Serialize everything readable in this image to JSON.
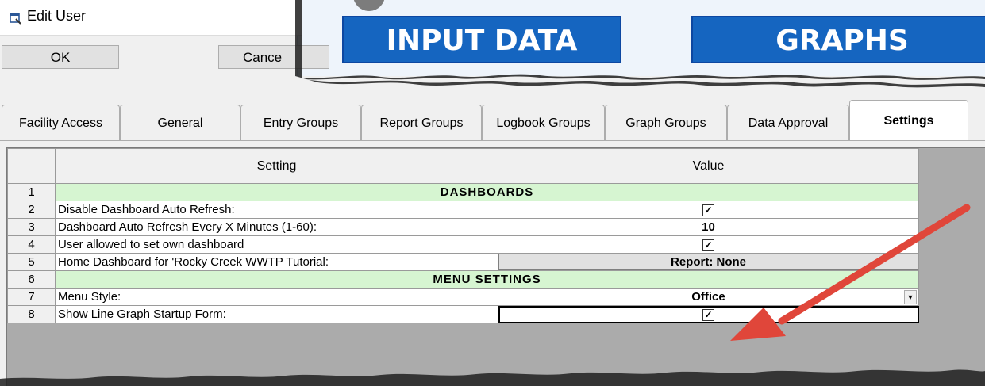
{
  "dialog": {
    "title": "Edit User",
    "ok_label": "OK",
    "cancel_label": "Cance"
  },
  "background_app": {
    "input_data_label": "INPUT DATA",
    "graphs_label": "GRAPHS"
  },
  "tabs": [
    {
      "label": "Facility Access",
      "active": false
    },
    {
      "label": "General",
      "active": false
    },
    {
      "label": "Entry Groups",
      "active": false
    },
    {
      "label": "Report Groups",
      "active": false
    },
    {
      "label": "Logbook Groups",
      "active": false
    },
    {
      "label": "Graph Groups",
      "active": false
    },
    {
      "label": "Data Approval",
      "active": false
    },
    {
      "label": "Settings",
      "active": true
    }
  ],
  "grid": {
    "headers": {
      "setting": "Setting",
      "value": "Value"
    },
    "rows": [
      {
        "num": "1",
        "section": "DASHBOARDS"
      },
      {
        "num": "2",
        "setting": "Disable Dashboard Auto Refresh:",
        "value_type": "checkbox",
        "checked": true
      },
      {
        "num": "3",
        "setting": "Dashboard Auto Refresh Every X Minutes (1-60):",
        "value": "10"
      },
      {
        "num": "4",
        "setting": "User allowed to set own dashboard",
        "value_type": "checkbox",
        "checked": true
      },
      {
        "num": "5",
        "setting": "Home Dashboard for 'Rocky Creek WWTP Tutorial:",
        "value": "Report: None"
      },
      {
        "num": "6",
        "section": "MENU SETTINGS"
      },
      {
        "num": "7",
        "setting": "Menu Style:",
        "value": "Office"
      },
      {
        "num": "8",
        "setting": "Show Line Graph Startup Form:",
        "value_type": "checkbox",
        "checked": true
      }
    ]
  },
  "colors": {
    "section_bg": "#d6f5d1",
    "accent_blue": "#1565c0",
    "arrow_red": "#e0463a"
  }
}
